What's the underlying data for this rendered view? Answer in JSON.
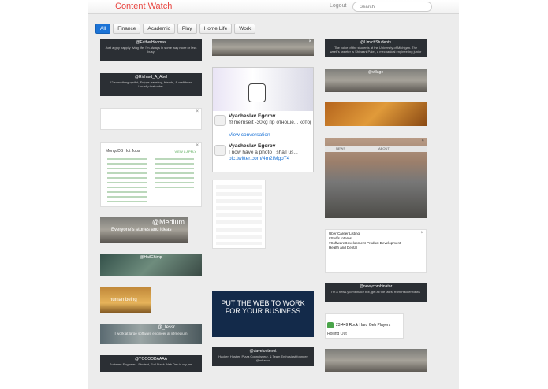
{
  "app": {
    "title": "Content Watch",
    "logout_label": "Logout",
    "search_placeholder": "Search"
  },
  "filters": [
    "All",
    "Finance",
    "Academic",
    "Play",
    "Home Life",
    "Work"
  ],
  "cards": {
    "fathom": {
      "handle": "@FatherHoomas",
      "bio": "Just a guy happily living life. I'm always in some way more or less busy"
    },
    "richard": {
      "handle": "@Richard_A_Abel",
      "bio": "12-something cyclist, Enjoys traveling, friends, & craft beer. Usually that order."
    },
    "mongo": {
      "title": "MongoDB Hot Jobs",
      "cta": "VIEW & APPLY"
    },
    "medium": {
      "handle": "@Medium",
      "bio": "Everyone's stories and ideas"
    },
    "hailchimp": {
      "handle": "@HailChimp"
    },
    "human": {
      "label": "human being"
    },
    "tessr": {
      "handle": "@_tessr",
      "bio": "I work at large software engineer at @medium"
    },
    "yo": {
      "handle": "@YOOOODAAAA",
      "bio": "Software Engineer - Student, Full Stack Web Dev is my jam"
    },
    "um": {
      "handle": "@UmichStudents",
      "bio": "The voice of the students at the University of Michigan. The week's tweeter is Shivaani Patel, a mechanical engineering junior"
    },
    "village": {
      "handle": "@village"
    },
    "yc": {
      "handle": "@newycombinator",
      "bio": "I'm a news.ycombinator bot, get all the latest from Hacker News"
    },
    "rock": {
      "text": "23,449 Rock Hard Geb Players",
      "sub": "Rolling Out"
    },
    "dfont": {
      "handle": "@davefontenot",
      "bio": "Hacker, Hustler, Pizza Connoisseur, & Team Enthusiast founder @mhacks"
    },
    "bluead": {
      "line1": "PUT THE WEB TO WORK",
      "line2": "FOR YOUR BUSINESS"
    },
    "tweet": {
      "name1": "Vyacheslav Egorov",
      "text1": "@mernseit -30kg пр отноше... которое было в возможн...",
      "link1": "View conversation",
      "name2": "Vyacheslav Egorov",
      "text2": "I now have a photo I shall us...",
      "link2": "pic.twitter.com/4m2iMgoT4"
    },
    "campus": {
      "tabs": [
        "NEWS",
        "ABOUT"
      ]
    },
    "list": {
      "rows": [
        "Uber Career Listing",
        "#Stuffs Interns",
        "#SoftwareDevelopment Product Development",
        "Health and Dental"
      ]
    }
  },
  "colors": {
    "accent": "#e8443f",
    "active_filter": "#1b73d6"
  }
}
